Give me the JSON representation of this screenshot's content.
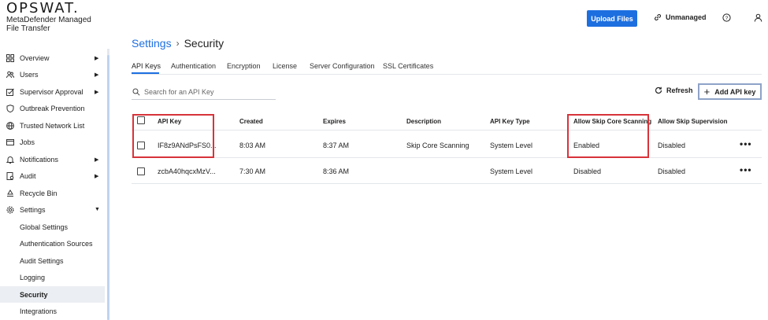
{
  "brand": {
    "logo": "OPSWAT.",
    "product_line1": "MetaDefender Managed",
    "product_line2": "File Transfer"
  },
  "header": {
    "upload_label": "Upload Files",
    "unmanaged_label": "Unmanaged",
    "help_icon": "help-circle-icon",
    "user_icon": "user-icon"
  },
  "sidebar": {
    "items": [
      {
        "label": "Overview",
        "icon": "grid-icon",
        "caret": "▶"
      },
      {
        "label": "Users",
        "icon": "users-icon",
        "caret": "▶"
      },
      {
        "label": "Supervisor Approval",
        "icon": "approval-icon",
        "caret": "▶"
      },
      {
        "label": "Outbreak Prevention",
        "icon": "shield-icon",
        "caret": ""
      },
      {
        "label": "Trusted Network List",
        "icon": "globe-icon",
        "caret": ""
      },
      {
        "label": "Jobs",
        "icon": "jobs-icon",
        "caret": ""
      },
      {
        "label": "Notifications",
        "icon": "bell-icon",
        "caret": "▶"
      },
      {
        "label": "Audit",
        "icon": "audit-icon",
        "caret": "▶"
      },
      {
        "label": "Recycle Bin",
        "icon": "recycle-icon",
        "caret": ""
      },
      {
        "label": "Settings",
        "icon": "gear-icon",
        "caret": "▼"
      }
    ],
    "subitems": [
      {
        "label": "Global Settings"
      },
      {
        "label": "Authentication Sources"
      },
      {
        "label": "Audit Settings"
      },
      {
        "label": "Logging"
      },
      {
        "label": "Security"
      },
      {
        "label": "Integrations"
      }
    ],
    "active_subitem": "Security"
  },
  "breadcrumb": {
    "parent": "Settings",
    "separator": "›",
    "current": "Security"
  },
  "tabs": [
    {
      "label": "API Keys",
      "active": true
    },
    {
      "label": "Authentication"
    },
    {
      "label": "Encryption"
    },
    {
      "label": "License"
    },
    {
      "label": "Server Configuration"
    },
    {
      "label": "SSL Certificates"
    }
  ],
  "search": {
    "placeholder": "Search for an API Key",
    "value": ""
  },
  "toolbar": {
    "refresh_label": "Refresh",
    "add_label": "Add API key"
  },
  "table": {
    "columns": [
      "API Key",
      "Created",
      "Expires",
      "Description",
      "API Key Type",
      "Allow Skip Core Scanning",
      "Allow Skip Supervision"
    ],
    "rows": [
      {
        "key": "IF8z9ANdPsFS0...",
        "created": "8:03 AM",
        "expires": "8:37 AM",
        "description": "Skip Core Scanning",
        "type": "System Level",
        "skip_core": "Enabled",
        "skip_supervision": "Disabled",
        "more": "•••"
      },
      {
        "key": "zcbA40hqcxMzV...",
        "created": "7:30 AM",
        "expires": "8:36 AM",
        "description": "",
        "type": "System Level",
        "skip_core": "Disabled",
        "skip_supervision": "Disabled",
        "more": "•••"
      }
    ]
  },
  "colors": {
    "accent": "#1d6fe0",
    "highlight": "#d8333a",
    "active_bg": "#ebeef2"
  }
}
